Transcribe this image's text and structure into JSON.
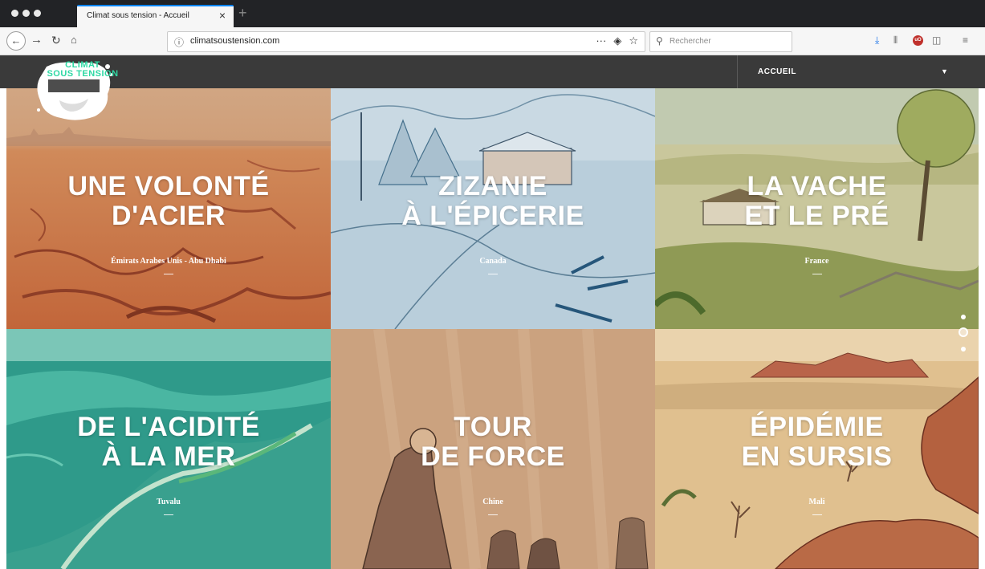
{
  "browser": {
    "tab_title": "Climat sous tension - Accueil",
    "tab_close": "×",
    "new_tab": "+",
    "url": "climatsoustension.com",
    "url_info_icon": "ⓘ",
    "url_more": "···",
    "search_placeholder": "Rechercher"
  },
  "site": {
    "logo_line1": "CLIMAT",
    "logo_line2": "SOUS TENSION",
    "nav_label": "ACCUEIL",
    "nav_caret": "▼",
    "accent_color": "#2ed9a4"
  },
  "tiles": [
    {
      "title_line1": "UNE VOLONTÉ",
      "title_line2": "D'ACIER",
      "country": "Émirats Arabes Unis - Abu Dhabi"
    },
    {
      "title_line1": "ZIZANIE",
      "title_line2": "À L'ÉPICERIE",
      "country": "Canada"
    },
    {
      "title_line1": "LA VACHE",
      "title_line2": "ET LE PRÉ",
      "country": "France"
    },
    {
      "title_line1": "DE L'ACIDITÉ",
      "title_line2": "À LA MER",
      "country": "Tuvalu"
    },
    {
      "title_line1": "TOUR",
      "title_line2": "DE FORCE",
      "country": "Chine"
    },
    {
      "title_line1": "ÉPIDÉMIE",
      "title_line2": "EN SURSIS",
      "country": "Mali"
    }
  ],
  "pager": {
    "pages": 3,
    "active_index": 1
  }
}
